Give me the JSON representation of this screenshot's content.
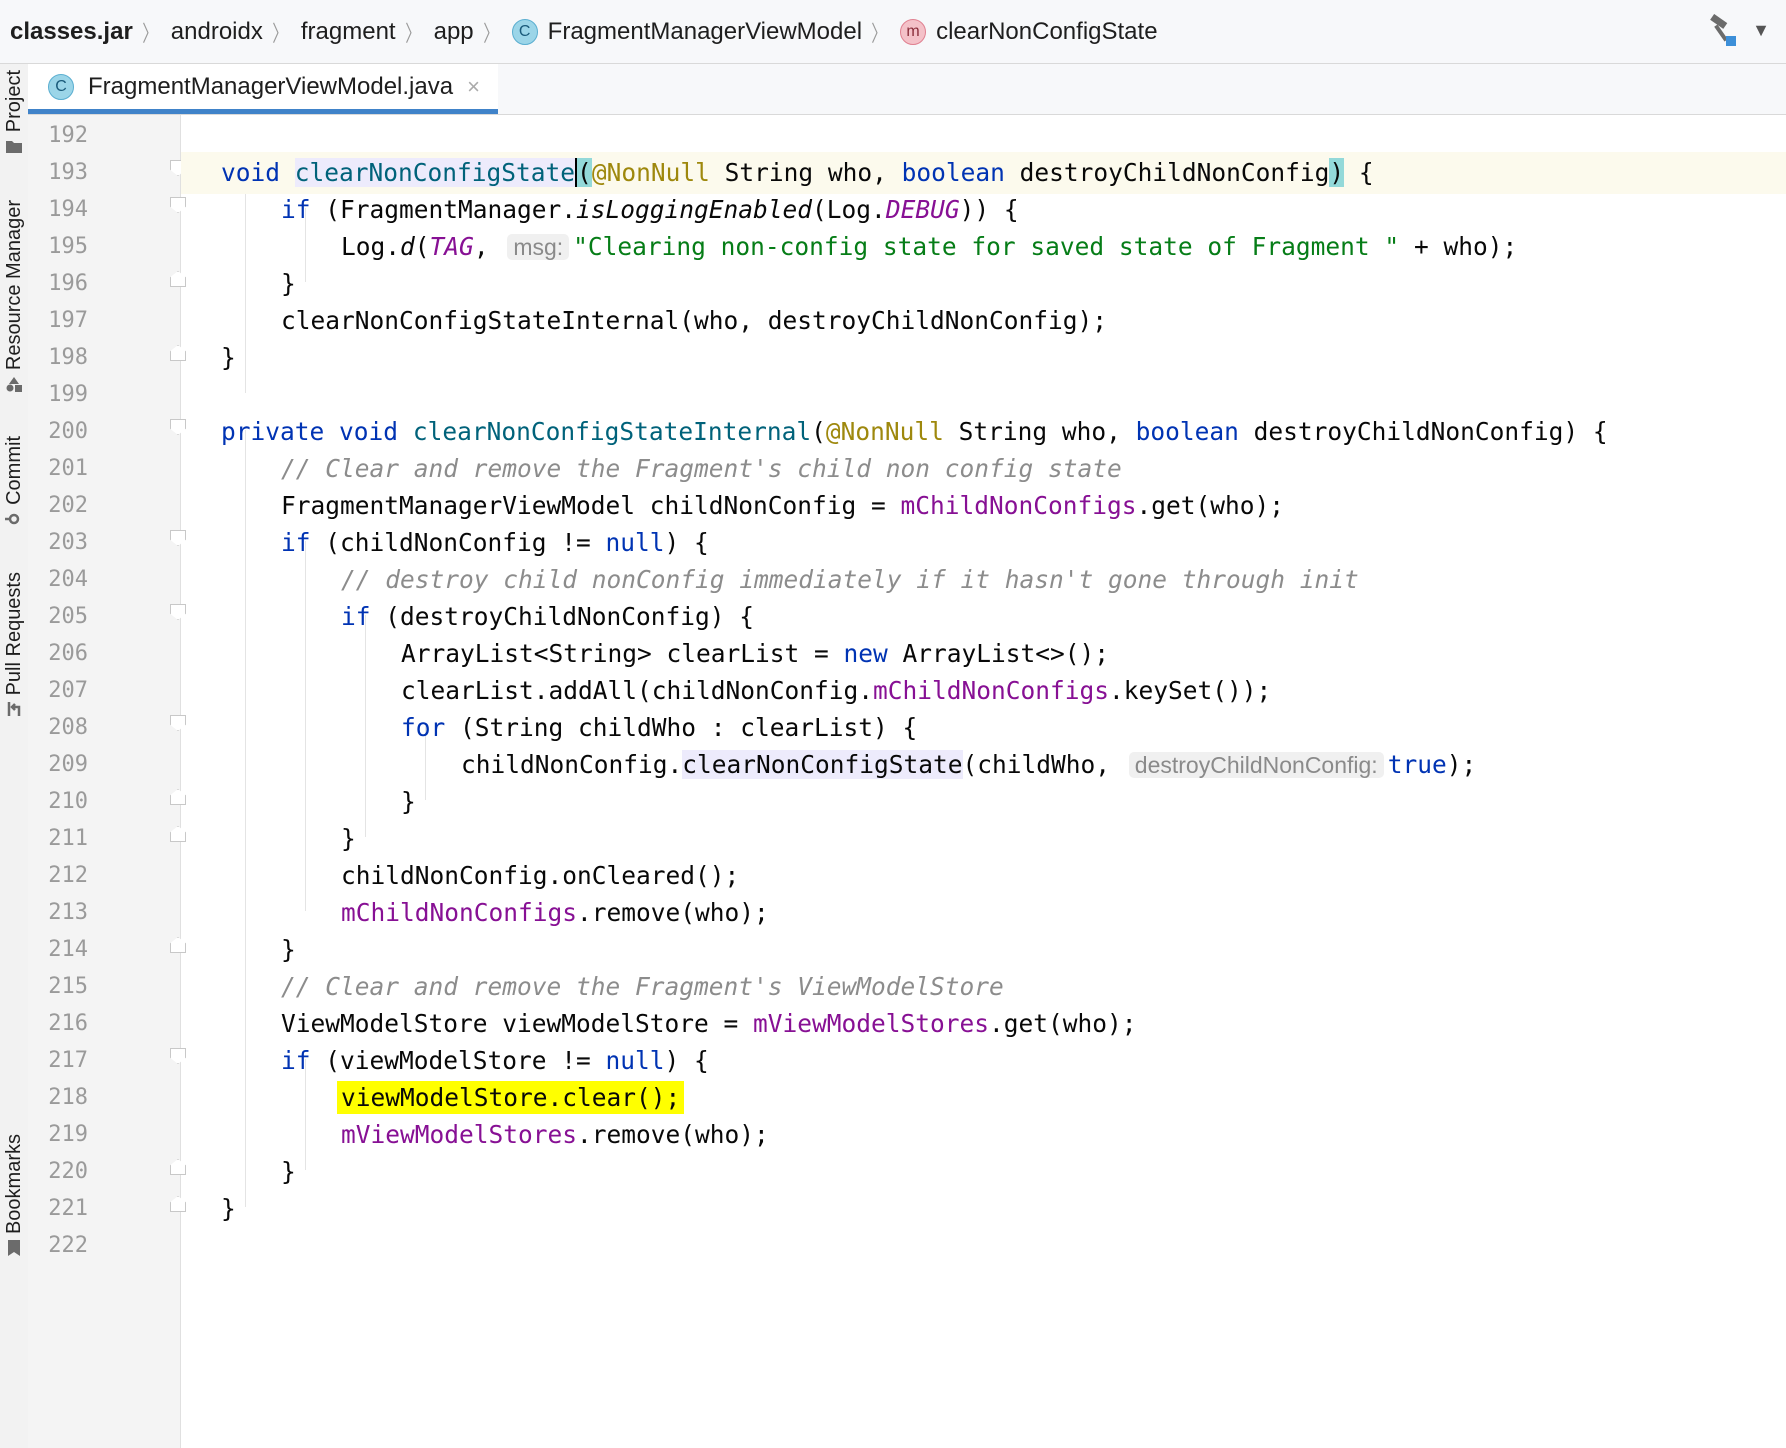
{
  "breadcrumb": {
    "items": [
      {
        "label": "classes.jar",
        "icon": ""
      },
      {
        "label": "androidx",
        "icon": ""
      },
      {
        "label": "fragment",
        "icon": ""
      },
      {
        "label": "app",
        "icon": ""
      },
      {
        "label": "FragmentManagerViewModel",
        "icon": "class-icon",
        "badge": "C"
      },
      {
        "label": "clearNonConfigState",
        "icon": "method-icon",
        "badge": "m"
      }
    ]
  },
  "left_strip": {
    "project": "Project",
    "resource_manager": "Resource Manager",
    "commit": "Commit",
    "pull_requests": "Pull Requests",
    "bookmarks": "Bookmarks"
  },
  "tab": {
    "badge": "C",
    "filename": "FragmentManagerViewModel.java",
    "close": "×"
  },
  "editor": {
    "line_numbers": [
      "192",
      "193",
      "194",
      "195",
      "196",
      "197",
      "198",
      "199",
      "200",
      "201",
      "202",
      "203",
      "204",
      "205",
      "206",
      "207",
      "208",
      "209",
      "210",
      "211",
      "212",
      "213",
      "214",
      "215",
      "216",
      "217",
      "218",
      "219",
      "220",
      "221",
      "222"
    ],
    "tokens": {
      "void": "void",
      "clearNonConfigState": "clearNonConfigState",
      "paren_open": "(",
      "NonNull": "@NonNull",
      "string_who_boolean": " String who, ",
      "boolean": "boolean",
      "destroyChildNonConfig": " destroyChildNonConfig",
      "paren_close": ")",
      "brace_open": " {",
      "l194_if": "if",
      "l194_a": " (FragmentManager.",
      "l194_isLogging": "isLoggingEnabled",
      "l194_b": "(Log.",
      "l194_debug": "DEBUG",
      "l194_c": ")) {",
      "l195_a": "Log.",
      "l195_d": "d",
      "l195_b": "(",
      "l195_tag": "TAG",
      "l195_comma": ", ",
      "l195_hint": "msg:",
      "l195_str": "\"Clearing non-config state for saved state of Fragment \"",
      "l195_c": " + who);",
      "close_brace": "}",
      "l197": "clearNonConfigStateInternal(who, destroyChildNonConfig);",
      "private": "private",
      "l200_fn": "clearNonConfigStateInternal",
      "l200_a": "(",
      "l200_b": " String who, ",
      "l200_c": " destroyChildNonConfig) {",
      "l201": "// Clear and remove the Fragment's child non config state",
      "l202_a": "FragmentManagerViewModel childNonConfig = ",
      "l202_fld": "mChildNonConfigs",
      "l202_b": ".get(who);",
      "l203_a": " (childNonConfig != ",
      "null": "null",
      "l203_b": ") {",
      "l204": "// destroy child nonConfig immediately if it hasn't gone through init",
      "l205_a": " (destroyChildNonConfig) {",
      "l206_a": "ArrayList<String> clearList = ",
      "new": "new",
      "l206_b": " ArrayList<>();",
      "l207_a": "clearList.addAll(childNonConfig.",
      "l207_b": ".keySet());",
      "for": "for",
      "l208_a": " (String childWho : clearList) {",
      "l209_a": "childNonConfig.",
      "l209_b": "(childWho, ",
      "l209_hint": "destroyChildNonConfig:",
      "true": "true",
      "l209_c": ");",
      "l212": "childNonConfig.onCleared();",
      "l213_b": ".remove(who);",
      "l215": "// Clear and remove the Fragment's ViewModelStore",
      "l216_a": "ViewModelStore viewModelStore = ",
      "l216_fld": "mViewModelStores",
      "l216_b": ".get(who);",
      "l217_a": " (viewModelStore != ",
      "l218": "viewModelStore.clear();",
      "l219_b": ".remove(who);"
    }
  },
  "colors": {
    "keyword": "#0033b3",
    "method": "#00627a",
    "annotation": "#9e880d",
    "string": "#067d17",
    "comment": "#8c8c8c",
    "field": "#871094",
    "highlight": "#ffff00"
  }
}
